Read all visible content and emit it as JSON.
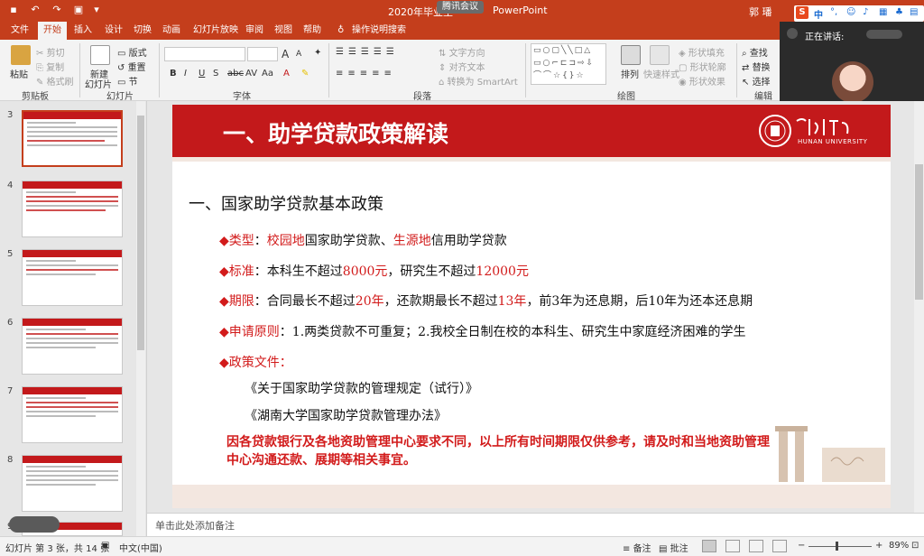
{
  "titlebar": {
    "doc_title": "2020年毕业生",
    "meeting_badge": "腾讯会议",
    "app_name": "PowerPoint",
    "user": "郭 璠"
  },
  "tabs": [
    "文件",
    "开始",
    "插入",
    "设计",
    "切换",
    "动画",
    "幻灯片放映",
    "审阅",
    "视图",
    "帮助",
    "操作说明搜索"
  ],
  "active_tab": "开始",
  "ribbon": {
    "clipboard": {
      "paste": "粘贴",
      "cut": "剪切",
      "copy": "复制",
      "format_painter": "格式刷",
      "label": "剪贴板"
    },
    "slides": {
      "new_slide": "新建",
      "new_slide2": "幻灯片",
      "layout": "版式",
      "reset": "重置",
      "section": "节",
      "label": "幻灯片"
    },
    "font": {
      "label": "字体",
      "bold": "B",
      "italic": "I",
      "underline": "U",
      "strike": "S",
      "shadow": "abc",
      "spacing": "AV",
      "case": "Aa",
      "grow": "A",
      "shrink": "A"
    },
    "paragraph": {
      "label": "段落",
      "text_direction": "文字方向",
      "align_text": "对齐文本",
      "smartart": "转换为 SmartArt"
    },
    "drawing": {
      "label": "绘图",
      "arrange": "排列",
      "quick_styles": "快速样式",
      "shape_fill": "形状填充",
      "shape_outline": "形状轮廓",
      "shape_effects": "形状效果"
    },
    "editing": {
      "label": "编辑",
      "find": "查找",
      "replace": "替换",
      "select": "选择"
    }
  },
  "thumbnails": [
    {
      "num": "3",
      "active": true
    },
    {
      "num": "4",
      "active": false
    },
    {
      "num": "5",
      "active": false
    },
    {
      "num": "6",
      "active": false
    },
    {
      "num": "7",
      "active": false
    },
    {
      "num": "8",
      "active": false
    },
    {
      "num": "9",
      "active": false
    }
  ],
  "slide": {
    "title": "一、助学贷款政策解读",
    "university_en": "HUNAN UNIVERSITY",
    "heading": "一、国家助学贷款基本政策",
    "type_label": "◆类型",
    "type_colon": "：",
    "type_a": "校园地",
    "type_a_rest": "国家助学贷款、",
    "type_b": "生源地",
    "type_b_rest": "信用助学贷款",
    "std_label": "◆标准",
    "std_text1": "：本科生不超过",
    "std_val1": "8000元",
    "std_text2": "，研究生不超过",
    "std_val2": "12000元",
    "term_label": "◆期限",
    "term_text1": "：合同最长不超过",
    "term_val1": "20年",
    "term_text2": "，还款期最长不超过",
    "term_val2": "13年",
    "term_text3": "，前3年为还息期，后10年为还本还息期",
    "apply_label": "◆申请原则",
    "apply_text": "：1.两类贷款不可重复；2.我校全日制在校的本科生、研究生中家庭经济困难的学生",
    "docs_label": "◆政策文件",
    "docs_colon": "：",
    "doc1": "《关于国家助学贷款的管理规定（试行）》",
    "doc2": "《湖南大学国家助学贷款管理办法》",
    "note": "因各贷款银行及各地资助管理中心要求不同，以上所有时间期限仅供参考，请及时和当地资助管理中心沟通还款、展期等相关事宜。"
  },
  "notes_placeholder": "单击此处添加备注",
  "statusbar": {
    "slide_info": "幻灯片 第 3 张，共 14 张",
    "language": "中文(中国)",
    "notes": "备注",
    "comments": "批注",
    "zoom": "89%"
  },
  "meeting": {
    "speaking": "正在讲话:",
    "participant": "郭璠"
  },
  "ime": {
    "logo": "S",
    "mode": "中"
  },
  "colors": {
    "ppt_accent": "#c43e1c",
    "slide_red": "#c3191b",
    "text_red": "#d21b1b"
  }
}
